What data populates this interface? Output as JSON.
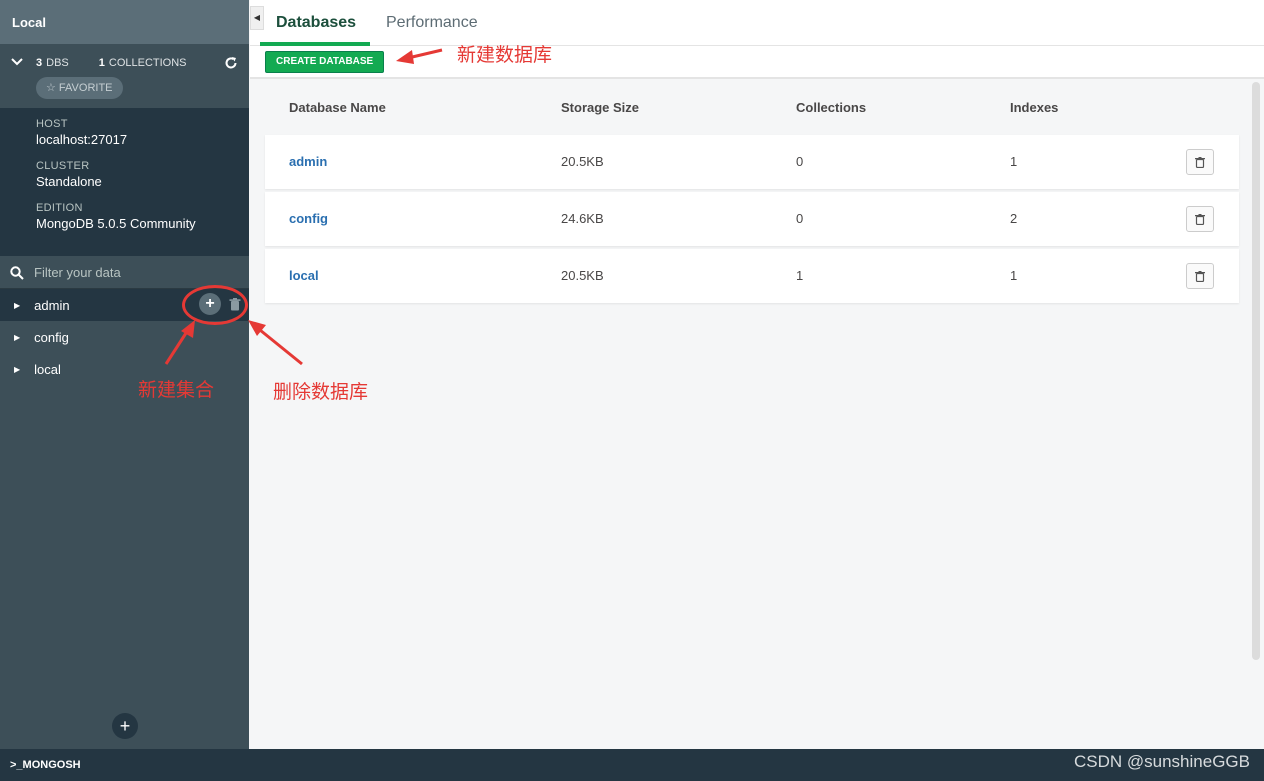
{
  "sidebar": {
    "title": "Local",
    "stats": {
      "dbs_count": "3",
      "dbs_label": "DBS",
      "collections_count": "1",
      "collections_label": "COLLECTIONS"
    },
    "favorite_label": "☆ FAVORITE",
    "info": [
      {
        "label": "HOST",
        "value": "localhost:27017"
      },
      {
        "label": "CLUSTER",
        "value": "Standalone"
      },
      {
        "label": "EDITION",
        "value": "MongoDB 5.0.5 Community"
      }
    ],
    "filter_placeholder": "Filter your data",
    "databases": [
      "admin",
      "config",
      "local"
    ]
  },
  "bottom_bar": {
    "label": ">_MONGOSH"
  },
  "watermark": "CSDN @sunshineGGB",
  "tabs": [
    {
      "label": "Databases"
    },
    {
      "label": "Performance"
    }
  ],
  "toolbar": {
    "create_label": "CREATE DATABASE"
  },
  "table": {
    "headers": [
      "Database Name",
      "Storage Size",
      "Collections",
      "Indexes"
    ],
    "rows": [
      {
        "name": "admin",
        "size": "20.5KB",
        "collections": "0",
        "indexes": "1"
      },
      {
        "name": "config",
        "size": "24.6KB",
        "collections": "0",
        "indexes": "2"
      },
      {
        "name": "local",
        "size": "20.5KB",
        "collections": "1",
        "indexes": "1"
      }
    ]
  },
  "annotations": {
    "create_db": "新建数据库",
    "create_collection": "新建集合",
    "delete_db": "删除数据库"
  },
  "colors": {
    "accent": "#13aa52",
    "annotation": "#e53935",
    "sidebar": "#3d4f58"
  }
}
